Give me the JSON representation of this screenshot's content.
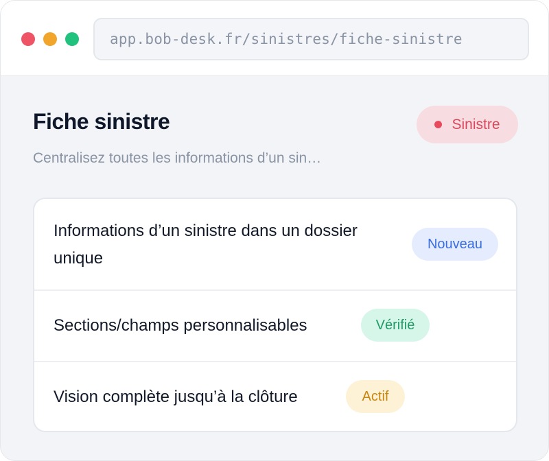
{
  "browser": {
    "url": "app.bob-desk.fr/sinistres/fiche-sinistre"
  },
  "header": {
    "title": "Fiche sinistre",
    "status_label": "Sinistre",
    "subtitle": "Centralisez toutes les informations d’un sin…"
  },
  "features": [
    {
      "label": "Informations d’un sinistre dans un dossier unique",
      "badge": "Nouveau",
      "badge_color": "#3b6fe0"
    },
    {
      "label": "Sections/champs personnalisables",
      "badge": "Vérifié",
      "badge_color": "#1f9a66"
    },
    {
      "label": "Vision complète jusqu’à la clôture",
      "badge": "Actif",
      "badge_color": "#c9870e"
    }
  ],
  "colors": {
    "status_accent": "#e8495c",
    "window_background": "#f2f4f8"
  }
}
